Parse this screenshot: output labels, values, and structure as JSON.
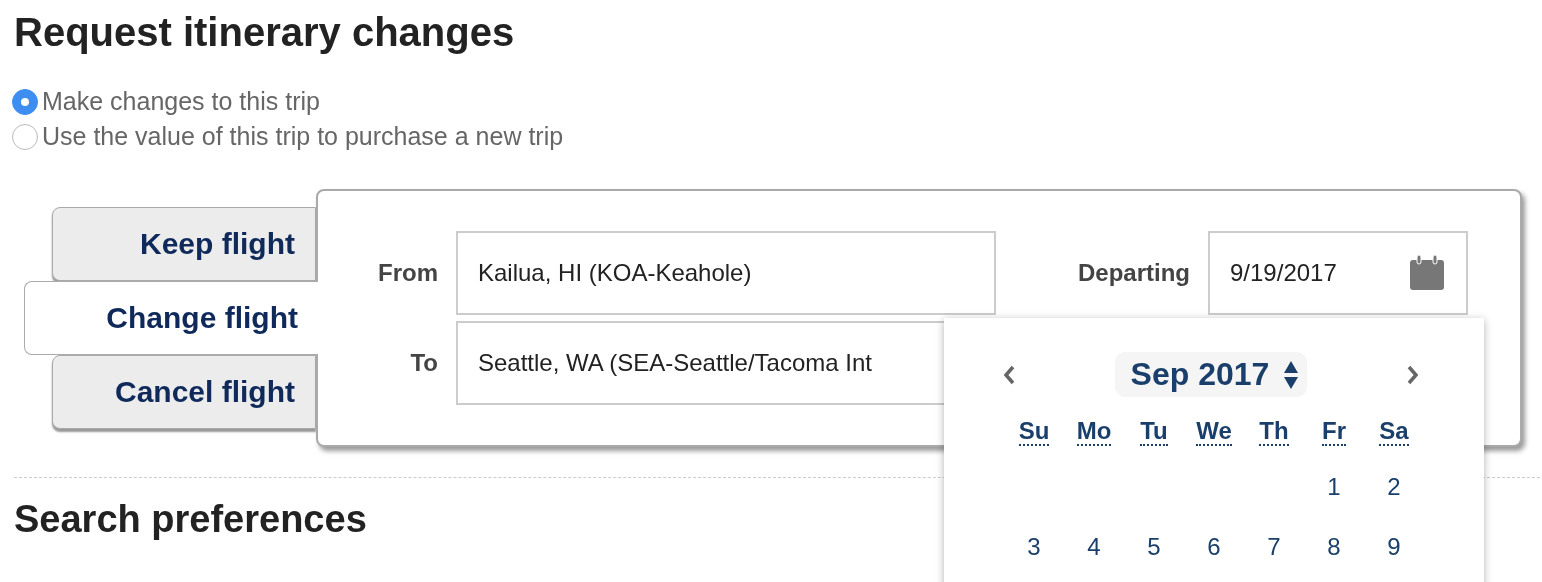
{
  "title": "Request itinerary changes",
  "options": [
    {
      "label": "Make changes to this trip",
      "selected": true
    },
    {
      "label": "Use the value of this trip to purchase a new trip",
      "selected": false
    }
  ],
  "tabs": [
    {
      "label": "Keep flight",
      "selected": false
    },
    {
      "label": "Change flight",
      "selected": true
    },
    {
      "label": "Cancel flight",
      "selected": false
    }
  ],
  "from": {
    "label": "From",
    "value": "Kailua, HI (KOA-Keahole)"
  },
  "to": {
    "label": "To",
    "value": "Seattle, WA (SEA-Seattle/Tacoma Int"
  },
  "departing": {
    "label": "Departing",
    "value": "9/19/2017"
  },
  "calendar": {
    "month": "Sep 2017",
    "weekdays": [
      "Su",
      "Mo",
      "Tu",
      "We",
      "Th",
      "Fr",
      "Sa"
    ],
    "weeks": [
      [
        "1",
        "2"
      ],
      [
        "3",
        "4",
        "5",
        "6",
        "7",
        "8",
        "9"
      ]
    ]
  },
  "section_title": "Search preferences"
}
